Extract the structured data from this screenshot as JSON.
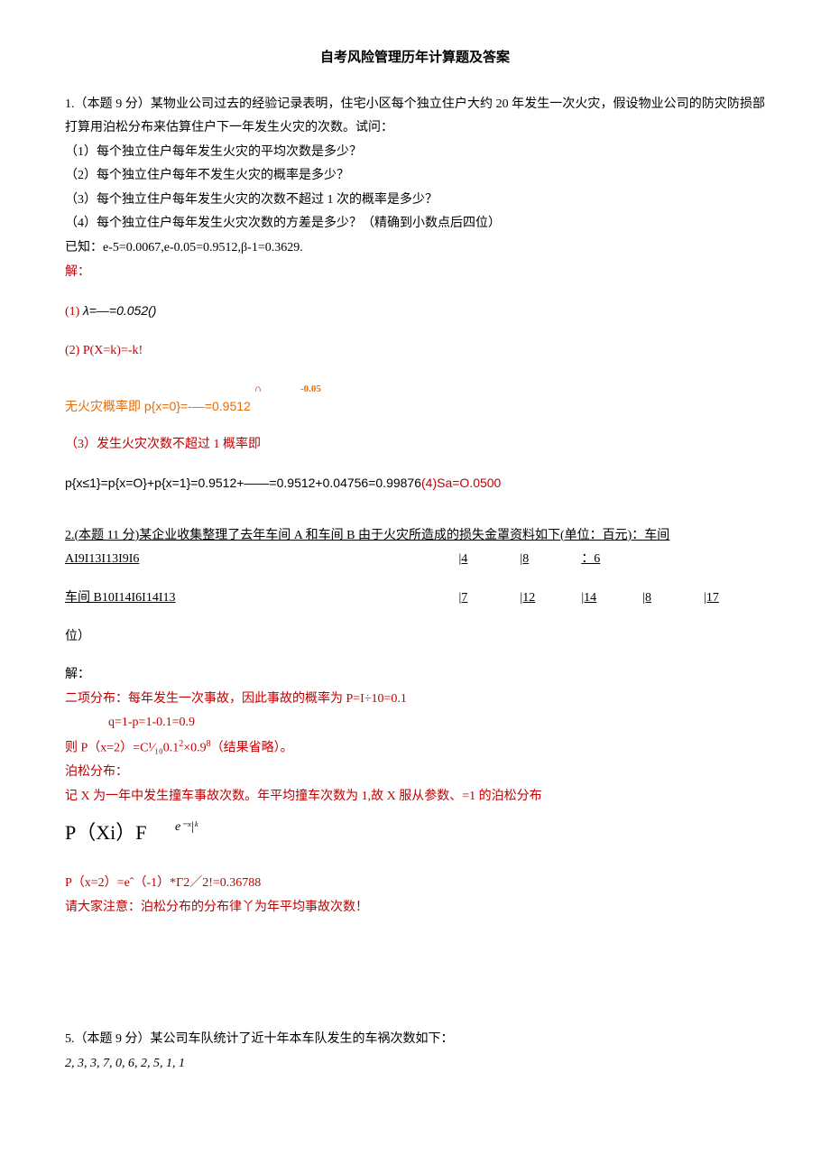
{
  "title": "自考风险管理历年计算题及答案",
  "q1": {
    "stem": "1.（本题 9 分）某物业公司过去的经验记录表明，住宅小区每个独立住户大约 20 年发生一次火灾，假设物业公司的防灾防损部打算用泊松分布来估算住户下一年发生火灾的次数。试问：",
    "i1": "（1）每个独立住户每年发生火灾的平均次数是多少？",
    "i2": "（2）每个独立住户每年不发生火灾的概率是多少？",
    "i3": "（3）每个独立住户每年发生火灾的次数不超过 1 次的概率是多少？",
    "i4": "（4）每个独立住户每年发生火灾次数的方差是多少？（精确到小数点后四位）",
    "given": "已知：e-5=0.0067,e-0.05=0.9512,β-1=0.3629.",
    "sol_label": "解：",
    "s1_a": "(1)    ",
    "s1_b": "λ=—=0.052()",
    "s2": "(2)    P(X=k)=-k!",
    "s2b_sup1": "∩",
    "s2b_sup2": "-0.05",
    "s2b": "无火灾概率即 p{x=0}=-—=0.9512",
    "s3": "（3）发生火灾次数不超过 1 概率即",
    "s4_a": "p{x≤1}=p{x=O}+p{x=1}=0.9512+——=0.9512+0.04756=0.99876",
    "s4_b": "(4)Sa=O.0500"
  },
  "q2": {
    "stem": "2.(本题 11 分)某企业收集整理了去年车间 A 和车间 B 由于火灾所造成的损失金罩资料如下(单位：百元)：车间",
    "rowA": {
      "label": "AI9I13I13I9I6",
      "c1": "|4",
      "c2": "|8",
      "c3": "：6",
      "c4": "",
      "c5": ""
    },
    "rowB": {
      "label": "车间 B10I14I6I14I13",
      "c1": "|7",
      "c2": "|12",
      "c3": "|14",
      "c4": "|8",
      "c5": "|17"
    },
    "tail": "位）",
    "sol_label": "解：",
    "line1": "二项分布：每年发生一次事故，因此事故的概率为 P=I÷10=0.1",
    "line2": "q=1-p=1-0.1=0.9",
    "line3a": "则 P（x=2）=C¹⁄₁₀0.1",
    "line3b": "2",
    "line3c": "×0.9",
    "line3d": "8",
    "line3e": "（结果省略）。",
    "poisson_label": "泊松分布：",
    "line4": "记 X 为一年中发生撞车事故次数。年平均撞车次数为 1,故 X 服从参数、=1 的泊松分布",
    "formula_main": "P（Xi）F",
    "formula_sup": "e⁻ˣ|ᵏ",
    "line5": "P（x=2）=eˆ（-1）*Γ2／2!=0.36788",
    "note": "请大家注意：泊松分布的分布律丫为年平均事故次数！"
  },
  "q5": {
    "stem": "5.（本题 9 分）某公司车队统计了近十年本车队发生的车祸次数如下：",
    "data": "2, 3, 3, 7, 0, 6, 2, 5, 1, 1"
  }
}
